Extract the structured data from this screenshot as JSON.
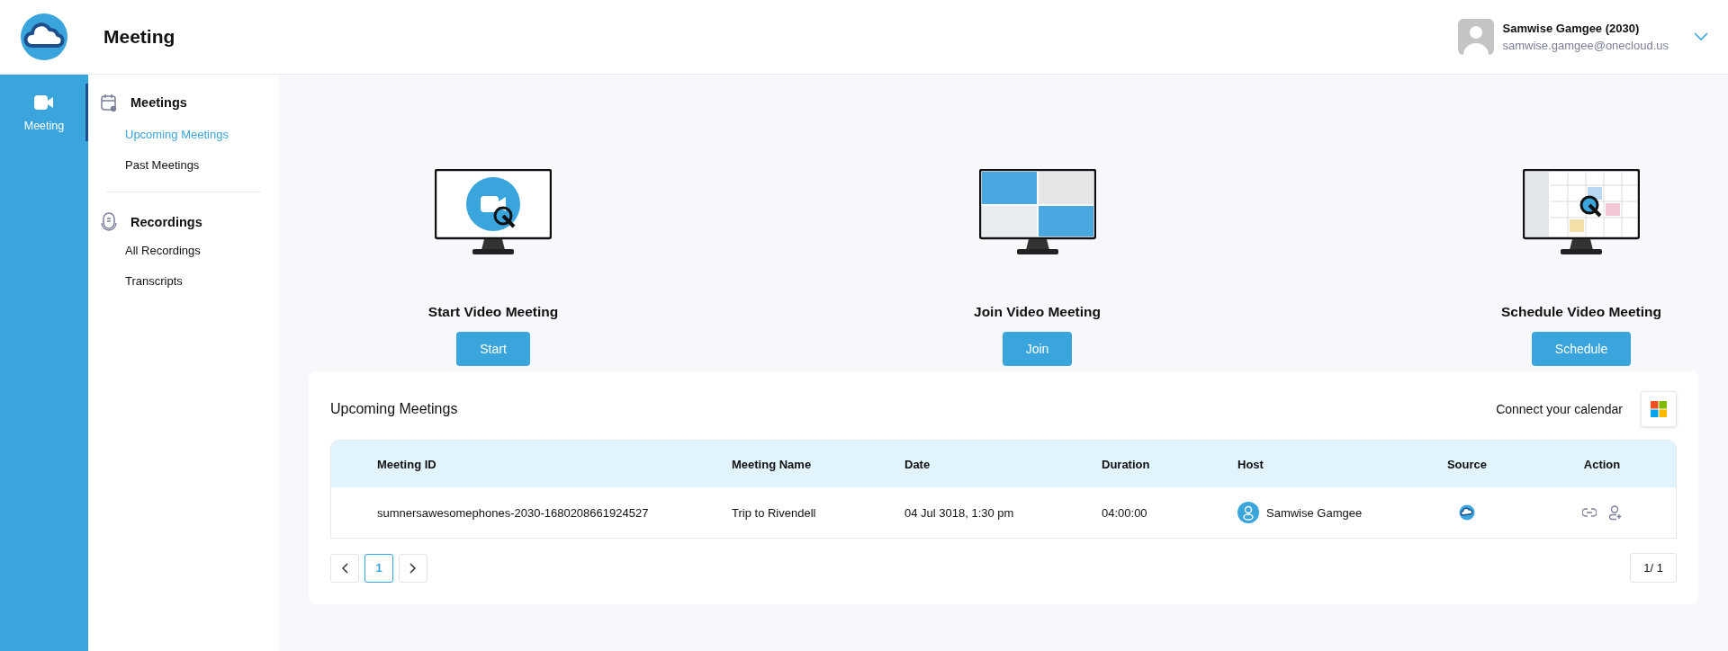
{
  "header": {
    "title": "Meeting",
    "user": {
      "name": "Samwise Gamgee (2030)",
      "email": "samwise.gamgee@onecloud.us"
    }
  },
  "rail": [
    {
      "label": "Meeting",
      "selected": true
    }
  ],
  "sidebar": [
    {
      "kind": "meetings",
      "title": "Meetings",
      "items": [
        {
          "label": "Upcoming Meetings",
          "selected": true
        },
        {
          "label": "Past Meetings",
          "selected": false
        }
      ]
    },
    {
      "kind": "recordings",
      "title": "Recordings",
      "items": [
        {
          "label": "All Recordings",
          "selected": false
        },
        {
          "label": "Transcripts",
          "selected": false
        }
      ]
    }
  ],
  "actions": [
    {
      "kind": "start",
      "title": "Start Video Meeting",
      "button": "Start"
    },
    {
      "kind": "join",
      "title": "Join Video Meeting",
      "button": "Join"
    },
    {
      "kind": "schedule",
      "title": "Schedule Video Meeting",
      "button": "Schedule"
    }
  ],
  "upcoming": {
    "title": "Upcoming Meetings",
    "connect_label": "Connect your calendar",
    "columns": [
      "Meeting ID",
      "Meeting Name",
      "Date",
      "Duration",
      "Host",
      "Source",
      "Action"
    ],
    "rows": [
      {
        "meeting_id": "sumnersawesomephones-2030-1680208661924527",
        "meeting_name": "Trip to Rivendell",
        "date": "04 Jul 3018, 1:30 pm",
        "duration": "04:00:00",
        "host": "Samwise Gamgee"
      }
    ],
    "pages": [
      {
        "label": "1",
        "selected": true
      }
    ],
    "page_count": "1/ 1"
  }
}
